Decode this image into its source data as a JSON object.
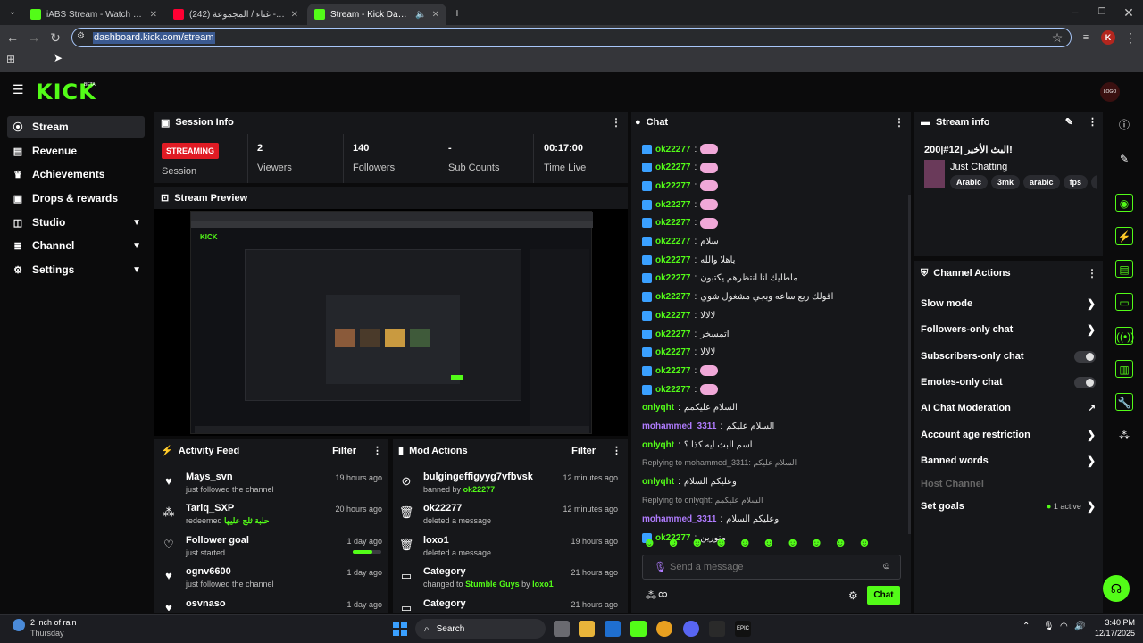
{
  "browser": {
    "tabs": [
      {
        "title": "iABS Stream - Watch Live on Ki",
        "color": "#53fc18"
      },
      {
        "title": "شومي له - غناء / المجموعة (242)",
        "color": "#ff0033"
      },
      {
        "title": "Stream - Kick Dashboard",
        "color": "#53fc18"
      }
    ],
    "url": "dashboard.kick.com/stream",
    "profile_initial": "K"
  },
  "brand": {
    "logo": "KICK",
    "beta": "BETA",
    "avatar_text": "LOGO"
  },
  "sidebar": {
    "items": [
      {
        "label": "Stream",
        "icon": "signal-icon"
      },
      {
        "label": "Revenue",
        "icon": "revenue-icon"
      },
      {
        "label": "Achievements",
        "icon": "trophy-icon"
      },
      {
        "label": "Drops & rewards",
        "icon": "gift-icon"
      },
      {
        "label": "Studio",
        "icon": "layout-icon"
      },
      {
        "label": "Channel",
        "icon": "channel-icon"
      },
      {
        "label": "Settings",
        "icon": "gear-icon"
      }
    ]
  },
  "session": {
    "title": "Session Info",
    "badge": "STREAMING",
    "session_label": "Session",
    "viewers": "2",
    "viewers_label": "Viewers",
    "followers": "140",
    "followers_label": "Followers",
    "subs": "-",
    "subs_label": "Sub Counts",
    "time": "00:17:00",
    "time_label": "Time Live"
  },
  "preview": {
    "title": "Stream Preview"
  },
  "activity": {
    "title": "Activity Feed",
    "filter": "Filter",
    "items": [
      {
        "name": "Mays_svn",
        "sub": "just followed the channel",
        "time": "19 hours ago"
      },
      {
        "name": "Tariq_SXP",
        "sub": "redeemed",
        "extra": "حلبة ثلج عليها",
        "time": "20 hours ago"
      },
      {
        "name": "Follower goal",
        "sub": "just started",
        "time": "1 day ago"
      },
      {
        "name": "ognv6600",
        "sub": "just followed the channel",
        "time": "1 day ago"
      },
      {
        "name": "osvnaso",
        "sub": "",
        "time": "1 day ago"
      }
    ]
  },
  "mod": {
    "title": "Mod Actions",
    "filter": "Filter",
    "items": [
      {
        "name": "bulgingeffigyyg7vfbvsk",
        "sub": "banned by",
        "by": "ok22277",
        "time": "12 minutes ago"
      },
      {
        "name": "ok22277",
        "sub": "deleted a message",
        "time": "12 minutes ago"
      },
      {
        "name": "loxo1",
        "sub": "deleted a message",
        "time": "19 hours ago"
      },
      {
        "name": "Category",
        "sub": "changed to",
        "by": "Stumble Guys",
        "by2": "by",
        "by3": "loxo1",
        "time": "21 hours ago"
      },
      {
        "name": "Category",
        "sub": "",
        "time": "21 hours ago"
      }
    ]
  },
  "chat": {
    "title": "Chat",
    "messages": [
      {
        "user": "ok22277",
        "text": "",
        "emote": true,
        "color": "#53fc18"
      },
      {
        "user": "ok22277",
        "text": "",
        "emote": true,
        "color": "#53fc18"
      },
      {
        "user": "ok22277",
        "text": "",
        "emote": true,
        "color": "#53fc18"
      },
      {
        "user": "ok22277",
        "text": "",
        "emote": true,
        "color": "#53fc18"
      },
      {
        "user": "ok22277",
        "text": "",
        "emote": true,
        "color": "#53fc18"
      },
      {
        "user": "ok22277",
        "text": "سلام",
        "color": "#53fc18"
      },
      {
        "user": "ok22277",
        "text": "ياهلا والله",
        "color": "#53fc18"
      },
      {
        "user": "ok22277",
        "text": "ماطليك انا انتظرهم يكتبون",
        "color": "#53fc18"
      },
      {
        "user": "ok22277",
        "text": "اقولك ربع ساعه وبجي مشغول شوي",
        "color": "#53fc18"
      },
      {
        "user": "ok22277",
        "text": "لالالا",
        "color": "#53fc18"
      },
      {
        "user": "ok22277",
        "text": "اتمسخر",
        "color": "#53fc18"
      },
      {
        "user": "ok22277",
        "text": "لالالا",
        "color": "#53fc18"
      },
      {
        "user": "ok22277",
        "text": "",
        "emote": true,
        "color": "#53fc18"
      },
      {
        "user": "ok22277",
        "text": "",
        "emote": true,
        "color": "#53fc18"
      },
      {
        "user": "onlyqht",
        "text": "السلام عليكمم",
        "color": "#53fc18",
        "nobadge": true
      },
      {
        "user": "mohammed_3311",
        "text": "السلام عليكم",
        "color": "#b07cff",
        "nobadge": true
      },
      {
        "user": "onlyqht",
        "text": "اسم البث ايه كذا ؟",
        "color": "#53fc18",
        "nobadge": true
      },
      {
        "reply": "Replying to mohammed_3311: السلام عليكم"
      },
      {
        "user": "onlyqht",
        "text": "وعليكم السلام",
        "color": "#53fc18",
        "nobadge": true
      },
      {
        "reply": "Replying to onlyqht: السلام عليكمم"
      },
      {
        "user": "mohammed_3311",
        "text": "وعليكم السلام",
        "color": "#b07cff",
        "nobadge": true
      },
      {
        "user": "ok22277",
        "text": "منورين",
        "color": "#53fc18"
      }
    ],
    "placeholder": "Send a message",
    "send_label": "Chat",
    "infinity": "∞"
  },
  "stream_info": {
    "title": "Stream info",
    "stream_title": "البث الأخير |12#|200!",
    "category": "Just Chatting",
    "tags": [
      "Arabic",
      "3mk",
      "arabic",
      "fps",
      "imo"
    ]
  },
  "channel_actions": {
    "title": "Channel Actions",
    "items": [
      {
        "label": "Slow mode",
        "kind": "arrow"
      },
      {
        "label": "Followers-only chat",
        "kind": "arrow"
      },
      {
        "label": "Subscribers-only chat",
        "kind": "toggle"
      },
      {
        "label": "Emotes-only chat",
        "kind": "toggle"
      },
      {
        "label": "AI Chat Moderation",
        "kind": "ext"
      },
      {
        "label": "Account age restriction",
        "kind": "arrow"
      },
      {
        "label": "Banned words",
        "kind": "arrow"
      },
      {
        "label": "Host Channel",
        "kind": "disabled"
      },
      {
        "label": "Set goals",
        "kind": "goal",
        "extra": "1 active"
      }
    ]
  },
  "taskbar": {
    "weather": "2 inch of rain",
    "weather_day": "Thursday",
    "search": "Search",
    "time": "3:40 PM",
    "date": "12/17/2025"
  }
}
